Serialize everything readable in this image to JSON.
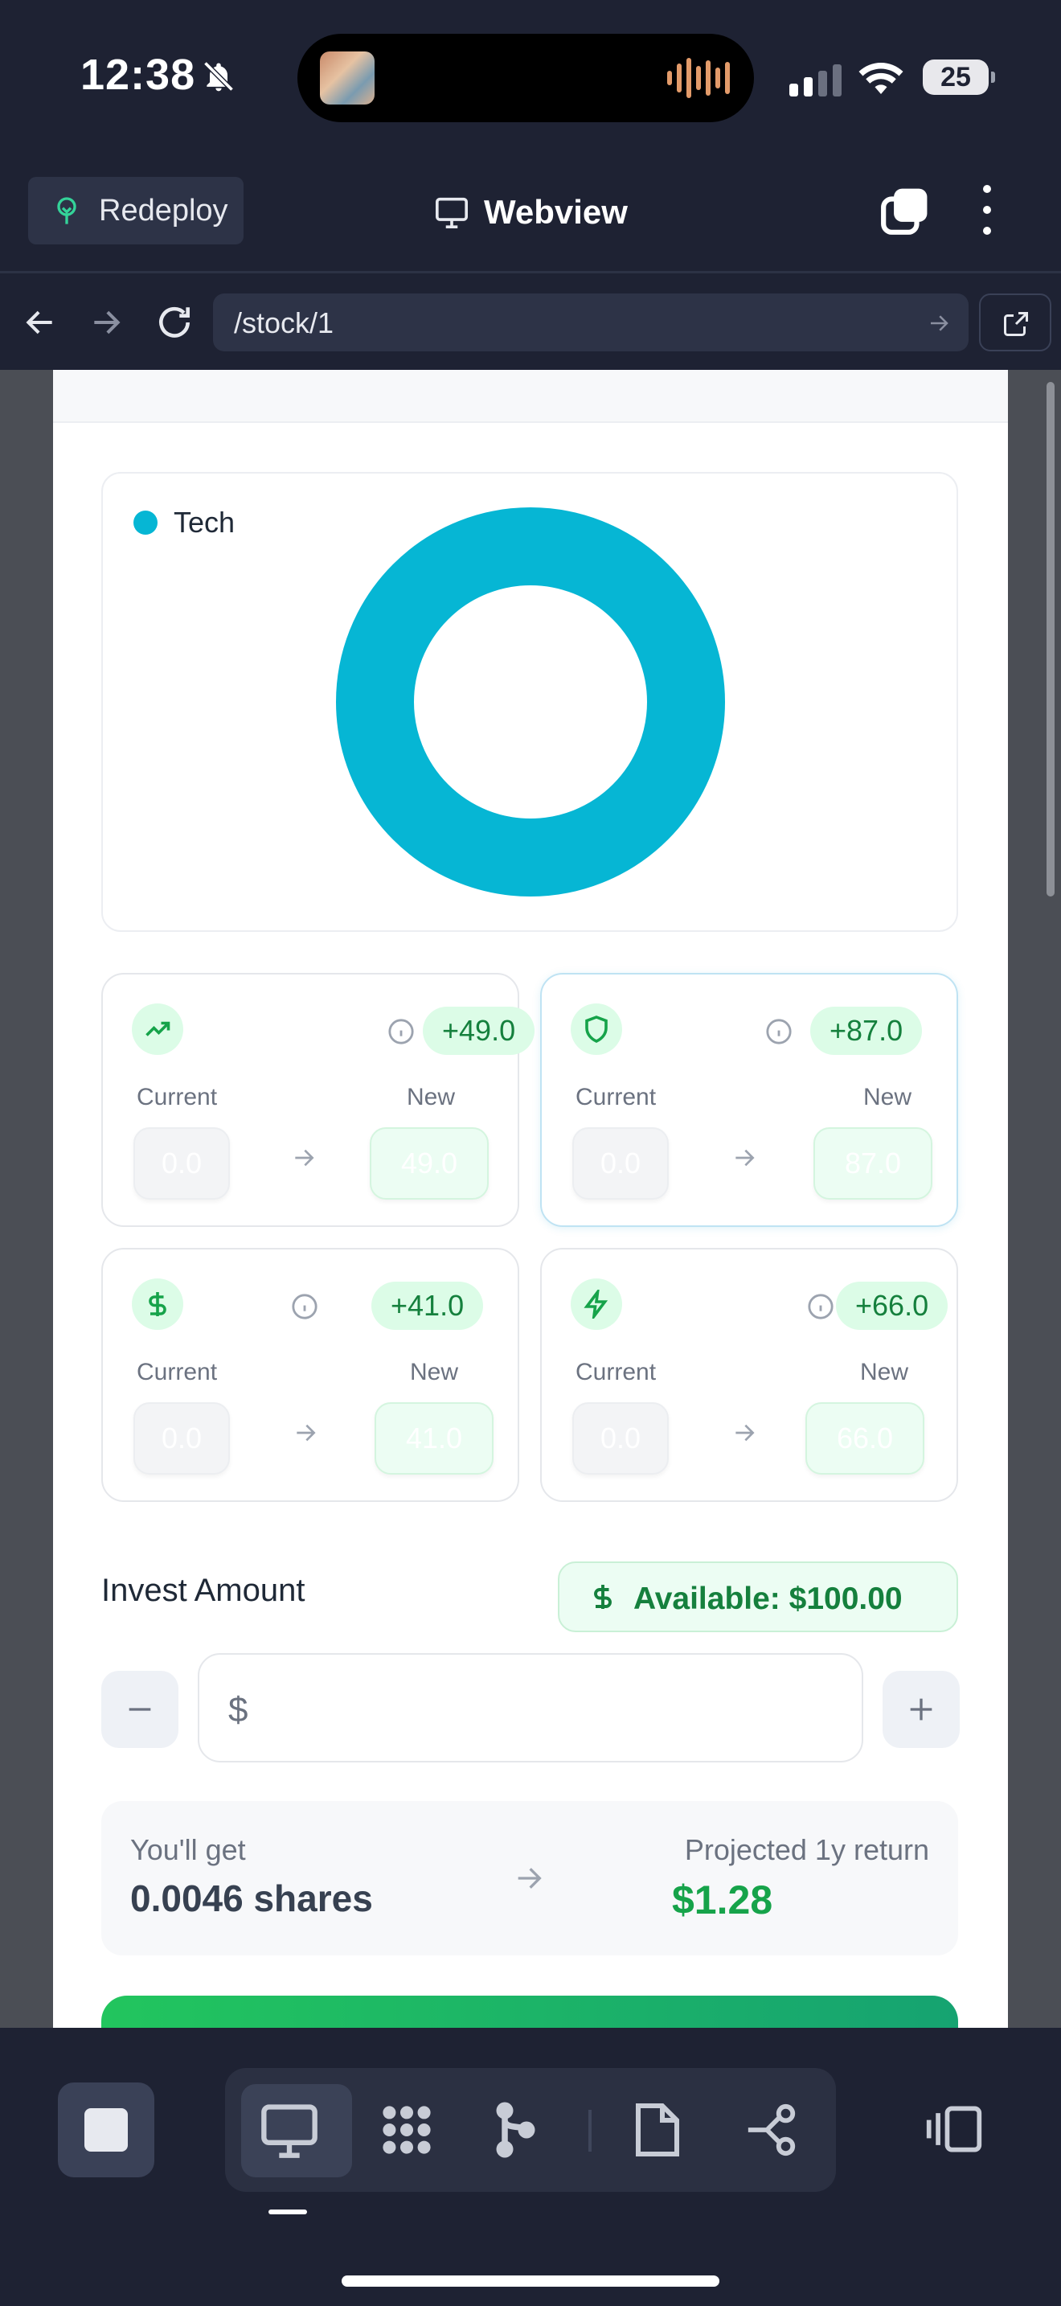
{
  "status_bar": {
    "time": "12:38",
    "battery": "25",
    "icons": [
      "bell-slash-icon",
      "signal-icon",
      "wifi-icon",
      "battery-icon"
    ]
  },
  "top_bar": {
    "redeploy_label": "Redeploy",
    "title": "Webview",
    "icons": [
      "tree-icon",
      "monitor-icon",
      "tabs-icon",
      "more-vertical-icon"
    ]
  },
  "url_bar": {
    "url": "/stock/1",
    "icons": [
      "back-arrow-icon",
      "forward-arrow-icon",
      "reload-icon",
      "go-arrow-icon",
      "external-link-icon"
    ]
  },
  "chart": {
    "legend_label": "Tech",
    "color": "#06b6d4"
  },
  "chart_data": {
    "type": "pie",
    "categories": [
      "Tech"
    ],
    "values": [
      100
    ],
    "colors": [
      "#06b6d4"
    ],
    "donut": true,
    "legend_position": "top-left"
  },
  "stats": [
    {
      "icon": "trending-up-icon",
      "delta": "+49.0",
      "current_label": "Current",
      "new_label": "New",
      "current": "0.0",
      "new": "49.0"
    },
    {
      "icon": "shield-icon",
      "delta": "+87.0",
      "current_label": "Current",
      "new_label": "New",
      "current": "0.0",
      "new": "87.0"
    },
    {
      "icon": "dollar-icon",
      "delta": "+41.0",
      "current_label": "Current",
      "new_label": "New",
      "current": "0.0",
      "new": "41.0"
    },
    {
      "icon": "lightning-icon",
      "delta": "+66.0",
      "current_label": "Current",
      "new_label": "New",
      "current": "0.0",
      "new": "66.0"
    }
  ],
  "invest": {
    "title": "Invest Amount",
    "available": "Available: $100.00",
    "currency_symbol": "$",
    "amount_value": ""
  },
  "result": {
    "shares_label": "You'll get",
    "shares_value": "0.0046 shares",
    "return_label": "Projected 1y return",
    "return_value": "$1.28"
  },
  "colors": {
    "accent_green": "#16a34a",
    "chart_cyan": "#06b6d4",
    "chrome_dark": "#1e2233"
  },
  "bottom_bar": {
    "icons": [
      "stop-icon",
      "monitor-icon",
      "apps-grid-icon",
      "branch-icon",
      "document-icon",
      "flow-icon",
      "panels-icon"
    ]
  }
}
